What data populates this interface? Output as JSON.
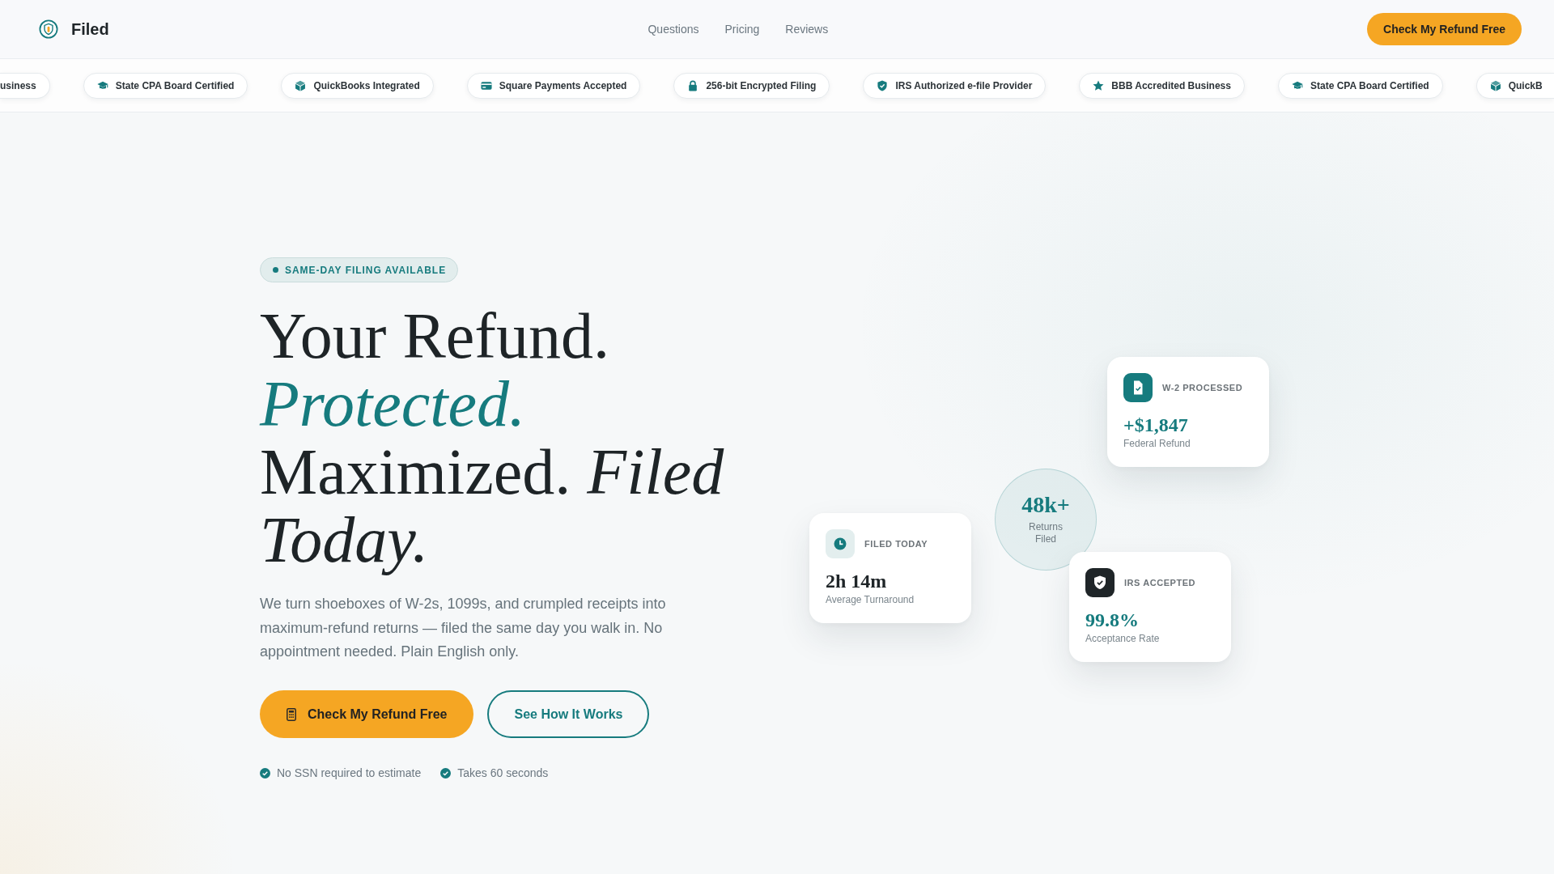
{
  "navbar": {
    "brand": "Filed",
    "links": [
      "Questions",
      "Pricing",
      "Reviews"
    ],
    "cta": "Check My Refund Free"
  },
  "trust_strip": [
    {
      "label": "usiness"
    },
    {
      "kind": "certification",
      "label": "State CPA Board Certified"
    },
    {
      "kind": "integration",
      "label": "QuickBooks Integrated"
    },
    {
      "kind": "payments",
      "label": "Square Payments Accepted"
    },
    {
      "kind": "encryption",
      "label": "256-bit Encrypted Filing"
    },
    {
      "kind": "authorization",
      "label": "IRS Authorized e-file Provider"
    },
    {
      "kind": "accreditation",
      "label": "BBB Accredited Business"
    },
    {
      "kind": "certification",
      "label": "State CPA Board Certified"
    },
    {
      "kind": "integration",
      "label": "QuickB"
    }
  ],
  "hero": {
    "eyebrow": "SAME-DAY FILING AVAILABLE",
    "heading": [
      {
        "kind": "plain",
        "text": "Your Refund."
      },
      {
        "kind": "accent",
        "text": "Protected."
      },
      {
        "kind": "plain",
        "text": "Maximized."
      },
      {
        "kind": "emphasis",
        "text": "Filed Today."
      }
    ],
    "description": "We turn shoeboxes of W-2s, 1099s, and crumpled receipts into maximum-refund returns — filed the same day you walk in. No appointment needed. Plain English only.",
    "primary_button": "Check My Refund Free",
    "secondary_button": "See How It Works",
    "notes": [
      "No SSN required to estimate",
      "Takes 60 seconds"
    ]
  },
  "stats": {
    "circle": {
      "value": "48k+",
      "label": "Returns Filed"
    },
    "cards": [
      {
        "kind": "refund",
        "label": "W-2 PROCESSED",
        "value": "+$1,847",
        "caption": "Federal Refund"
      },
      {
        "kind": "turnaround",
        "label": "FILED TODAY",
        "value": "2h 14m",
        "caption": "Average Turnaround"
      },
      {
        "kind": "acceptance",
        "label": "IRS ACCEPTED",
        "value": "99.8%",
        "caption": "Acceptance Rate"
      }
    ]
  }
}
